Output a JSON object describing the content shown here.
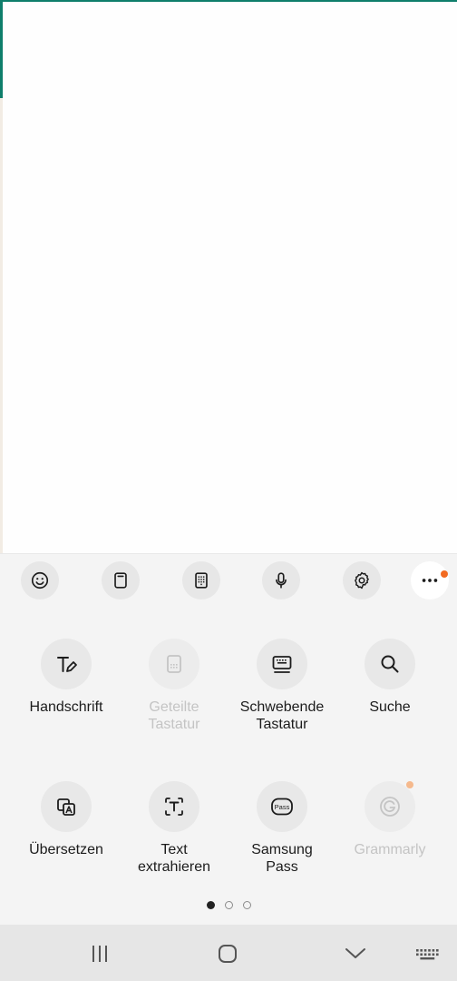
{
  "toolbar": {
    "icons": [
      "emoji-icon",
      "clipboard-icon",
      "keypad-icon",
      "microphone-icon",
      "settings-icon",
      "more-icon"
    ],
    "accent_color": "#f26a21"
  },
  "grid": {
    "row1": [
      {
        "label": "Handschrift",
        "icon": "handwriting-icon",
        "enabled": true
      },
      {
        "label": "Geteilte\nTastatur",
        "icon": "split-keyboard-icon",
        "enabled": false
      },
      {
        "label": "Schwebende\nTastatur",
        "icon": "floating-keyboard-icon",
        "enabled": true
      },
      {
        "label": "Suche",
        "icon": "search-icon",
        "enabled": true
      }
    ],
    "row2": [
      {
        "label": "Übersetzen",
        "icon": "translate-icon",
        "enabled": true
      },
      {
        "label": "Text\nextrahieren",
        "icon": "extract-text-icon",
        "enabled": true
      },
      {
        "label": "Samsung\nPass",
        "icon": "samsung-pass-icon",
        "enabled": true,
        "icon_text": "Pass"
      },
      {
        "label": "Grammarly",
        "icon": "grammarly-icon",
        "enabled": false
      }
    ]
  },
  "pager": {
    "pages": 3,
    "current": 1
  },
  "navbar": {
    "icons": [
      "recent-apps-icon",
      "home-icon",
      "hide-keyboard-icon",
      "keyboard-switch-icon"
    ]
  },
  "colors": {
    "teal": "#0f7e6b",
    "panel": "#f4f4f4",
    "navbar": "#e6e6e6"
  }
}
